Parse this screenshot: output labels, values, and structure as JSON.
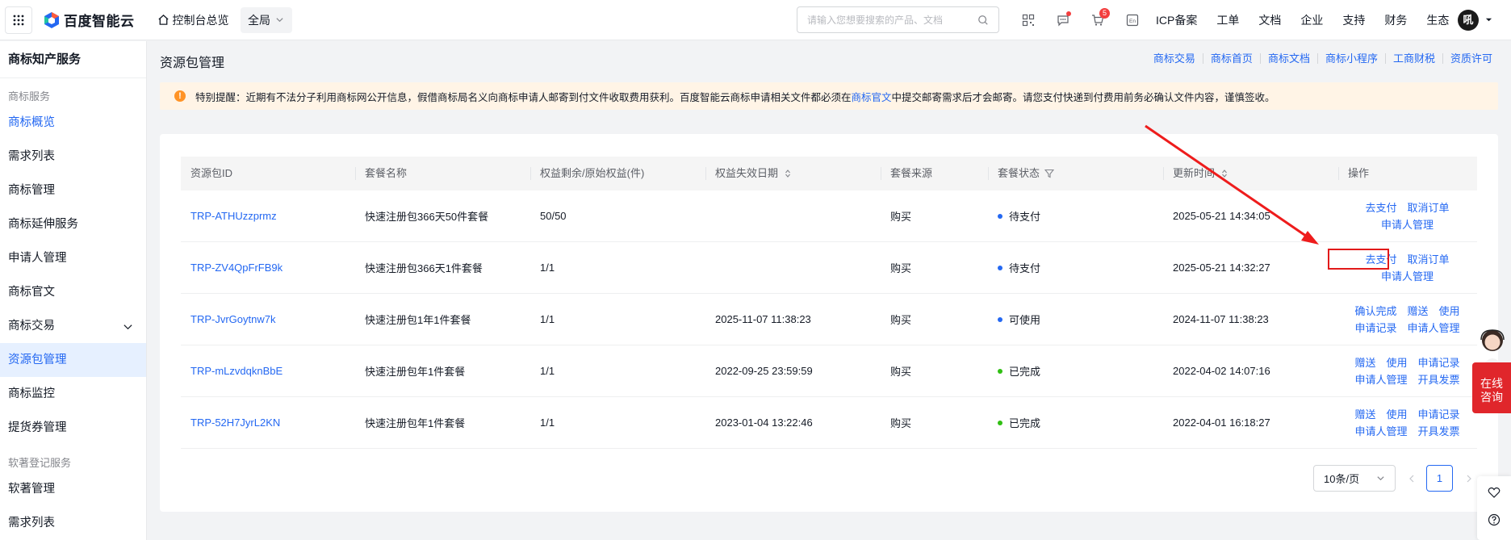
{
  "topbar": {
    "brand": "百度智能云",
    "home_label": "控制台总览",
    "scope": "全局",
    "search_placeholder": "请输入您想要搜索的产品、文档",
    "cart_count": "5",
    "nav": [
      "ICP备案",
      "工单",
      "文档",
      "企业",
      "支持",
      "财务",
      "生态"
    ],
    "avatar_text": "吼"
  },
  "sidebar": {
    "title": "商标知产服务",
    "group1": "商标服务",
    "items": [
      {
        "label": "商标概览"
      },
      {
        "label": "需求列表"
      },
      {
        "label": "商标管理"
      },
      {
        "label": "商标延伸服务"
      },
      {
        "label": "申请人管理"
      },
      {
        "label": "商标官文"
      },
      {
        "label": "商标交易"
      },
      {
        "label": "资源包管理"
      },
      {
        "label": "商标监控"
      },
      {
        "label": "提货券管理"
      }
    ],
    "group2": "软著登记服务",
    "items2": [
      {
        "label": "软著管理"
      },
      {
        "label": "需求列表"
      }
    ]
  },
  "page": {
    "title": "资源包管理",
    "links": [
      "商标交易",
      "商标首页",
      "商标文档",
      "商标小程序",
      "工商财税",
      "资质许可"
    ]
  },
  "notice": {
    "icon": "!",
    "before": "特别提醒：近期有不法分子利用商标网公开信息，假借商标局名义向商标申请人邮寄到付文件收取费用获利。百度智能云商标申请相关文件都必须在",
    "link": "商标官文",
    "after": "中提交邮寄需求后才会邮寄。请您支付快递到付费用前务必确认文件内容，谨慎签收。"
  },
  "table": {
    "columns": [
      "资源包ID",
      "套餐名称",
      "权益剩余/原始权益(件)",
      "权益失效日期",
      "套餐来源",
      "套餐状态",
      "更新时间",
      "操作"
    ],
    "rows": [
      {
        "id": "TRP-ATHUzzprmz",
        "name": "快速注册包366天50件套餐",
        "quota": "50/50",
        "expire": "",
        "source": "购买",
        "status": "待支付",
        "updated": "2025-05-21 14:34:05",
        "ops1": [
          "去支付",
          "取消订单"
        ],
        "ops2": [
          "申请人管理"
        ]
      },
      {
        "id": "TRP-ZV4QpFrFB9k",
        "name": "快速注册包366天1件套餐",
        "quota": "1/1",
        "expire": "",
        "source": "购买",
        "status": "待支付",
        "updated": "2025-05-21 14:32:27",
        "ops1": [
          "去支付",
          "取消订单"
        ],
        "ops2": [
          "申请人管理"
        ]
      },
      {
        "id": "TRP-JvrGoytnw7k",
        "name": "快速注册包1年1件套餐",
        "quota": "1/1",
        "expire": "2025-11-07 11:38:23",
        "source": "购买",
        "status": "可使用",
        "updated": "2024-11-07 11:38:23",
        "ops1": [
          "确认完成",
          "赠送",
          "使用"
        ],
        "ops2": [
          "申请记录",
          "申请人管理"
        ]
      },
      {
        "id": "TRP-mLzvdqknBbE",
        "name": "快速注册包年1件套餐",
        "quota": "1/1",
        "expire": "2022-09-25 23:59:59",
        "source": "购买",
        "status": "已完成",
        "updated": "2022-04-02 14:07:16",
        "ops1": [
          "赠送",
          "使用",
          "申请记录"
        ],
        "ops2": [
          "申请人管理",
          "开具发票"
        ]
      },
      {
        "id": "TRP-52H7JyrL2KN",
        "name": "快速注册包年1件套餐",
        "quota": "1/1",
        "expire": "2023-01-04 13:22:46",
        "source": "购买",
        "status": "已完成",
        "updated": "2022-04-01 16:18:27",
        "ops1": [
          "赠送",
          "使用",
          "申请记录"
        ],
        "ops2": [
          "申请人管理",
          "开具发票"
        ]
      }
    ],
    "status_colors": {
      "待支付": "#2468f2",
      "可使用": "#2468f2",
      "已完成": "#30bf13"
    }
  },
  "pager": {
    "page_size": "10条/页",
    "current": "1"
  },
  "float": {
    "consult_line1": "在线",
    "consult_line2": "咨询"
  }
}
